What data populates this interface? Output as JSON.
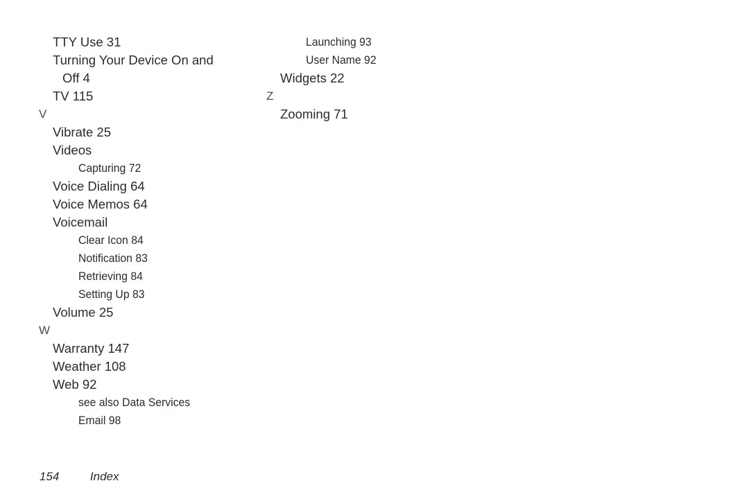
{
  "page": {
    "background_color": "#ffffff",
    "text_color": "#2b2b2b",
    "heading_color": "#4a4a4a"
  },
  "footer": {
    "page_number": "154",
    "title": "Index"
  },
  "columns": [
    {
      "name": "left-column",
      "lines": [
        {
          "type": "level1",
          "text": "TTY Use 31"
        },
        {
          "type": "level1",
          "text": "Turning Your Device On and",
          "continuation": "Off 4"
        },
        {
          "type": "level1",
          "text": "TV 115"
        },
        {
          "type": "heading",
          "text": "V"
        },
        {
          "type": "level1",
          "text": "Vibrate 25"
        },
        {
          "type": "level1",
          "text": "Videos"
        },
        {
          "type": "level2",
          "text": "Capturing 72"
        },
        {
          "type": "level1",
          "text": "Voice Dialing 64"
        },
        {
          "type": "level1",
          "text": "Voice Memos 64"
        },
        {
          "type": "level1",
          "text": "Voicemail"
        },
        {
          "type": "level2",
          "text": "Clear Icon 84"
        },
        {
          "type": "level2",
          "text": "Notification 83"
        },
        {
          "type": "level2",
          "text": "Retrieving 84"
        },
        {
          "type": "level2",
          "text": "Setting Up 83"
        },
        {
          "type": "level1",
          "text": "Volume 25"
        },
        {
          "type": "heading",
          "text": "W"
        },
        {
          "type": "level1",
          "text": "Warranty 147"
        },
        {
          "type": "level1",
          "text": "Weather 108"
        },
        {
          "type": "level1",
          "text": "Web 92"
        },
        {
          "type": "level2",
          "text": "see also Data Services"
        },
        {
          "type": "level2",
          "text": "Email 98"
        }
      ]
    },
    {
      "name": "right-column",
      "lines": [
        {
          "type": "level2",
          "text": "Launching 93"
        },
        {
          "type": "level2",
          "text": "User Name 92"
        },
        {
          "type": "level1",
          "text": "Widgets 22"
        },
        {
          "type": "heading",
          "text": "Z"
        },
        {
          "type": "level1",
          "text": "Zooming 71"
        }
      ]
    }
  ]
}
